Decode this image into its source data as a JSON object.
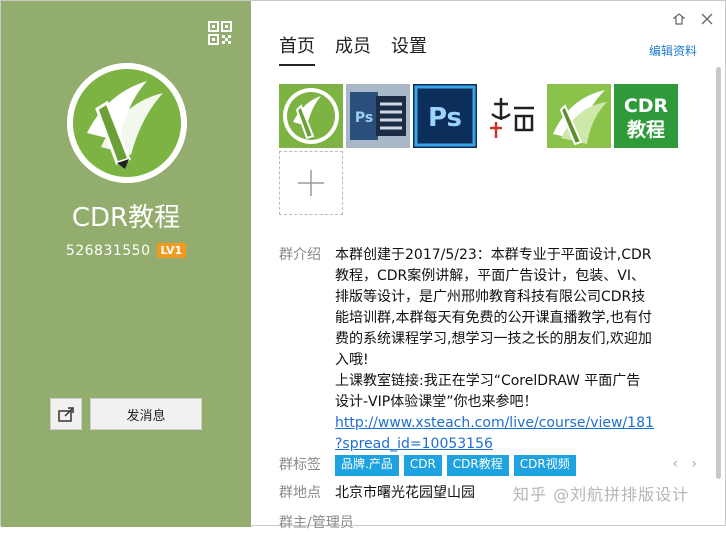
{
  "group": {
    "name": "CDR教程",
    "id": "526831550",
    "level": "LV1",
    "send_button": "发消息"
  },
  "tabs": [
    {
      "label": "首页"
    },
    {
      "label": "成员"
    },
    {
      "label": "设置"
    }
  ],
  "edit_profile": "编辑资料",
  "info": {
    "intro_label": "群介绍",
    "intro_lines": [
      "本群创建于2017/5/23：本群专业于平面设计,CDR",
      "教程，CDR案例讲解，平面广告设计，包装、VI、",
      "排版等设计，是广州邢帅教育科技有限公司CDR技",
      "能培训群,本群每天有免费的公开课直播教学,也有付",
      "费的系统课程学习,想学习一技之长的朋友们,欢迎加",
      "入哦!",
      "上课教室链接:我正在学习“CorelDRAW 平面广告",
      "设计-VIP体验课堂”你也来参吧！"
    ],
    "link_lines": [
      "http://www.xsteach.com/live/course/view/181",
      "?spread_id=10053156"
    ],
    "tags_label": "群标签",
    "tags": [
      "品牌.产品",
      "CDR",
      "CDR教程",
      "CDR视频"
    ],
    "location_label": "群地点",
    "location": "北京市曙光花园望山园",
    "admin_label": "群主/管理员"
  },
  "watermark": "知乎 @刘航拼排版设计",
  "colors": {
    "sidebar": "#93ad6e",
    "accent_link": "#1f7ad1",
    "tag_bg": "#1ea3e0",
    "level_badge": "#f29a1f"
  },
  "icons": [
    "qr-code-icon",
    "share-icon",
    "skin-icon",
    "close-icon",
    "plus-icon",
    "chevron-left-icon",
    "chevron-right-icon"
  ]
}
